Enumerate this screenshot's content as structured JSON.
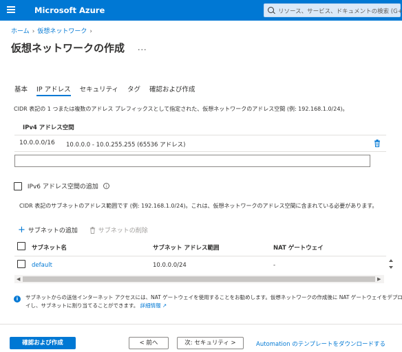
{
  "topbar": {
    "brand": "Microsoft Azure",
    "search_placeholder": "リソース、サービス、ドキュメントの検索 (G+/)"
  },
  "breadcrumb": {
    "items": [
      "ホーム",
      "仮想ネットワーク"
    ]
  },
  "page": {
    "title": "仮想ネットワークの作成",
    "more": "..."
  },
  "tabs": [
    {
      "label": "基本",
      "active": false
    },
    {
      "label": "IP アドレス",
      "active": true
    },
    {
      "label": "セキュリティ",
      "active": false
    },
    {
      "label": "タグ",
      "active": false
    },
    {
      "label": "確認および作成",
      "active": false
    }
  ],
  "address_space": {
    "description": "CIDR 表記の 1 つまたは複数のアドレス プレフィックスとして指定された、仮想ネットワークのアドレス空間 (例: 192.168.1.0/24)。",
    "header": "IPv4 アドレス空間",
    "rows": [
      {
        "cidr": "10.0.0.0/16",
        "range": "10.0.0.0 - 10.0.255.255 (65536 アドレス)"
      }
    ],
    "input_value": ""
  },
  "ipv6": {
    "label": "IPv6 アドレス空間の追加",
    "checked": false
  },
  "subnets": {
    "description": "CIDR 表記のサブネットのアドレス範囲です (例: 192.168.1.0/24)。これは、仮想ネットワークのアドレス空間に含まれている必要があります。",
    "add_label": "サブネットの追加",
    "delete_label": "サブネットの削除",
    "columns": [
      "サブネット名",
      "サブネット アドレス範囲",
      "NAT ゲートウェイ"
    ],
    "rows": [
      {
        "name": "default",
        "range": "10.0.0.0/24",
        "nat": "-"
      }
    ]
  },
  "notice": {
    "text": "サブネットからの送信インターネット アクセスには、NAT ゲートウェイを使用することをお勧めします。仮想ネットワークの作成後に NAT ゲートウェイをデプロイし、サブネットに割り当てることができます。",
    "link": "詳細情報"
  },
  "footer": {
    "review_create": "確認および作成",
    "prev": "< 前へ",
    "next": "次: セキュリティ >",
    "download_link": "Automation のテンプレートをダウンロードする"
  },
  "colors": {
    "accent": "#0078d4",
    "text": "#323130",
    "border": "#8a8886"
  }
}
